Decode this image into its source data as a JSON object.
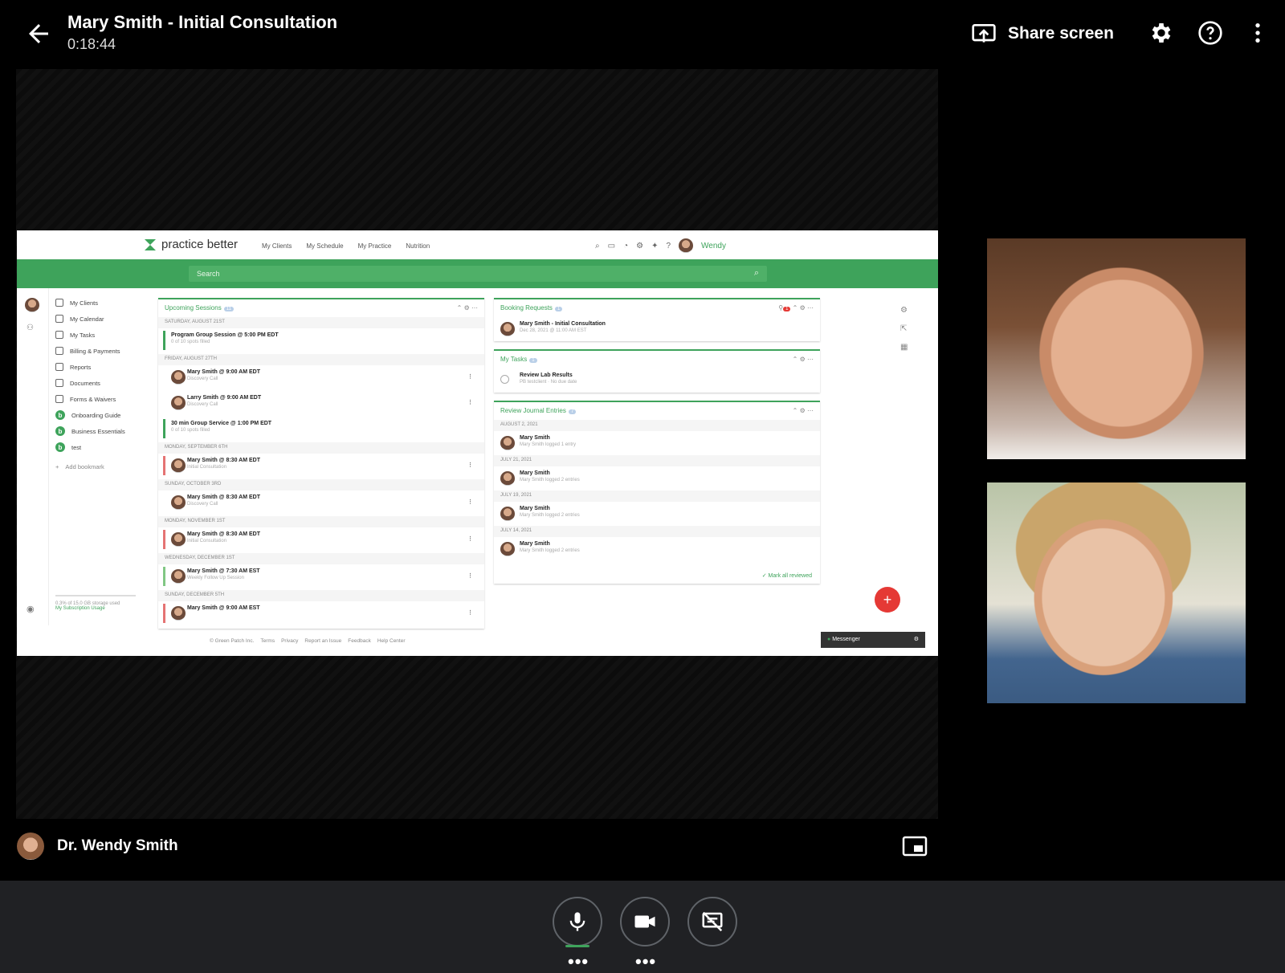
{
  "meeting": {
    "title": "Mary Smith - Initial Consultation",
    "timer": "0:18:44",
    "share_label": "Share screen",
    "presenter_name": "Dr. Wendy Smith"
  },
  "app": {
    "brand": "practice better",
    "nav": [
      "My Clients",
      "My Schedule",
      "My Practice",
      "Nutrition"
    ],
    "user": "Wendy",
    "search_placeholder": "Search",
    "sidebar": [
      {
        "label": "My Clients",
        "icon": "clients-icon"
      },
      {
        "label": "My Calendar",
        "icon": "calendar-icon"
      },
      {
        "label": "My Tasks",
        "icon": "tasks-icon"
      },
      {
        "label": "Billing & Payments",
        "icon": "billing-icon"
      },
      {
        "label": "Reports",
        "icon": "reports-icon"
      },
      {
        "label": "Documents",
        "icon": "documents-icon"
      },
      {
        "label": "Forms & Waivers",
        "icon": "forms-icon"
      },
      {
        "label": "Onboarding Guide",
        "icon": "b-icon"
      },
      {
        "label": "Business Essentials",
        "icon": "b-icon"
      },
      {
        "label": "test",
        "icon": "b-icon"
      }
    ],
    "add_bookmark": "Add bookmark",
    "storage": "0.3% of 15.0 GB storage used",
    "subscription": "My Subscription Usage",
    "upcoming": {
      "title": "Upcoming Sessions",
      "count": "11",
      "groups": [
        {
          "date": "Saturday, August 21st",
          "items": [
            {
              "title": "Program Group Session @ 5:00 PM EDT",
              "sub": "0 of 10 spots filled",
              "color": "#3ea35b",
              "avatar": false
            }
          ]
        },
        {
          "date": "Friday, August 27th",
          "items": [
            {
              "title": "Mary Smith @ 9:00 AM EDT",
              "sub": "Discovery Call",
              "color": "",
              "avatar": true
            },
            {
              "title": "Larry Smith @ 9:00 AM EDT",
              "sub": "Discovery Call",
              "color": "",
              "avatar": true
            },
            {
              "title": "30 min Group Service @ 1:00 PM EDT",
              "sub": "0 of 10 spots filled",
              "color": "#3ea35b",
              "avatar": false
            }
          ]
        },
        {
          "date": "Monday, September 6th",
          "items": [
            {
              "title": "Mary Smith @ 8:30 AM EDT",
              "sub": "Initial Consultation",
              "color": "#e57373",
              "avatar": true
            }
          ]
        },
        {
          "date": "Sunday, October 3rd",
          "items": [
            {
              "title": "Mary Smith @ 8:30 AM EDT",
              "sub": "Discovery Call",
              "color": "",
              "avatar": true
            }
          ]
        },
        {
          "date": "Monday, November 1st",
          "items": [
            {
              "title": "Mary Smith @ 8:30 AM EDT",
              "sub": "Initial Consultation",
              "color": "#e57373",
              "avatar": true
            }
          ]
        },
        {
          "date": "Wednesday, December 1st",
          "items": [
            {
              "title": "Mary Smith @ 7:30 AM EST",
              "sub": "Weekly Follow Up Session",
              "color": "#81c784",
              "avatar": true
            }
          ]
        },
        {
          "date": "Sunday, December 5th",
          "items": [
            {
              "title": "Mary Smith @ 9:00 AM EST",
              "sub": "",
              "color": "#e57373",
              "avatar": true
            }
          ]
        }
      ]
    },
    "booking": {
      "title": "Booking Requests",
      "count": "1",
      "filter_count": "1",
      "item": "Mary Smith - Initial Consultation",
      "item_sub": "Dec 28, 2021 @ 11:00 AM EST"
    },
    "tasks": {
      "title": "My Tasks",
      "count": "1",
      "item": "Review Lab Results",
      "client": "PB testclient",
      "due": "No due date"
    },
    "journal": {
      "title": "Review Journal Entries",
      "count": "7",
      "groups": [
        {
          "date": "August 2, 2021",
          "name": "Mary Smith",
          "sub": "Mary Smith logged 1 entry"
        },
        {
          "date": "July 21, 2021",
          "name": "Mary Smith",
          "sub": "Mary Smith logged 2 entries"
        },
        {
          "date": "July 19, 2021",
          "name": "Mary Smith",
          "sub": "Mary Smith logged 2 entries"
        },
        {
          "date": "July 14, 2021",
          "name": "Mary Smith",
          "sub": "Mary Smith logged 2 entries"
        }
      ],
      "mark_all": "Mark all reviewed"
    },
    "footer": [
      "© Green Patch Inc.",
      "Terms",
      "Privacy",
      "Report an Issue",
      "Feedback",
      "Help Center"
    ],
    "messenger": "Messenger"
  }
}
